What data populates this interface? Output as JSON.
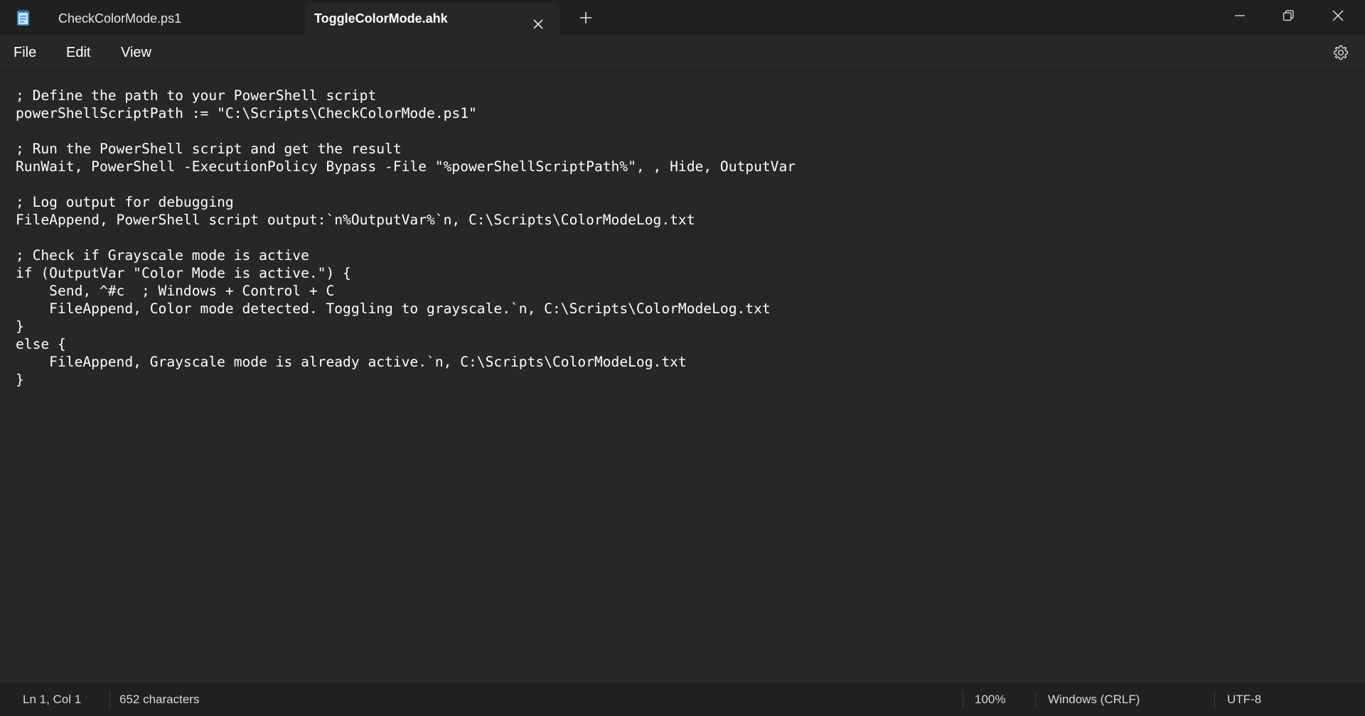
{
  "titlebar": {
    "app_icon": "notepad-icon",
    "tabs": [
      {
        "label": "CheckColorMode.ps1",
        "active": false
      },
      {
        "label": "ToggleColorMode.ahk",
        "active": true
      }
    ],
    "tab_close_icon": "close-icon",
    "new_tab_icon": "plus-icon",
    "window_controls": [
      "minimize-icon",
      "restore-icon",
      "close-icon"
    ]
  },
  "menu": {
    "items": [
      "File",
      "Edit",
      "View"
    ],
    "settings_icon": "gear-icon"
  },
  "editor": {
    "content": "; Define the path to your PowerShell script\npowerShellScriptPath := \"C:\\Scripts\\CheckColorMode.ps1\"\n\n; Run the PowerShell script and get the result\nRunWait, PowerShell -ExecutionPolicy Bypass -File \"%powerShellScriptPath%\", , Hide, OutputVar\n\n; Log output for debugging\nFileAppend, PowerShell script output:`n%OutputVar%`n, C:\\Scripts\\ColorModeLog.txt\n\n; Check if Grayscale mode is active\nif (OutputVar \"Color Mode is active.\") {\n    Send, ^#c  ; Windows + Control + C\n    FileAppend, Color mode detected. Toggling to grayscale.`n, C:\\Scripts\\ColorModeLog.txt\n}\nelse {\n    FileAppend, Grayscale mode is already active.`n, C:\\Scripts\\ColorModeLog.txt\n}"
  },
  "statusbar": {
    "position": "Ln 1, Col 1",
    "characters": "652 characters",
    "zoom": "100%",
    "line_ending": "Windows (CRLF)",
    "encoding": "UTF-8"
  },
  "colors": {
    "titlebar_bg": "#202020",
    "editor_bg": "#272727",
    "statusbar_bg": "#202020",
    "text": "#ffffff",
    "notepad_icon": "#3b8fd6"
  }
}
